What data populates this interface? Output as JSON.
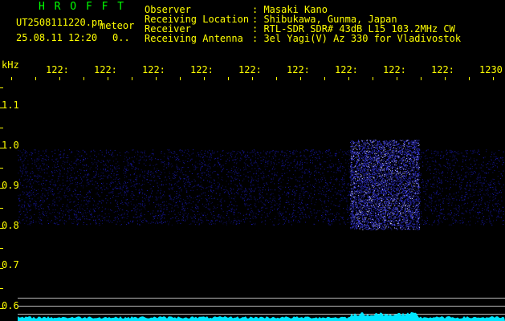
{
  "header": {
    "program_name": "H R O F F T",
    "filename": "UT2508111220.pn",
    "tag": "meteor",
    "datetime": "25.08.11 12:20",
    "count": "0..",
    "info_labels": [
      "Observer",
      "Receiving Location",
      "Receiver",
      "Receiving Antenna"
    ],
    "info_values": [
      ": Masaki Kano",
      ": Shibukawa, Gunma, Japan",
      ": RTL-SDR SDR# 43dB L15 103.2MHz CW",
      ": 3el Yagi(V) Az 330 for Vladivostok"
    ]
  },
  "axes": {
    "y_unit": "kHz",
    "y_ticks": [
      "1.1",
      "1.0",
      "0.9",
      "0.8",
      "0.7",
      "0.6"
    ],
    "x_ticks": [
      "122:",
      "122:",
      "122:",
      "122:",
      "122:",
      "122:",
      "122:",
      "122:",
      "122:",
      "1230"
    ]
  },
  "colors": {
    "background": "#000000",
    "label": "#ffff00",
    "title": "#00ff00",
    "signal": "#3a3aff",
    "level": "#00ffff"
  }
}
